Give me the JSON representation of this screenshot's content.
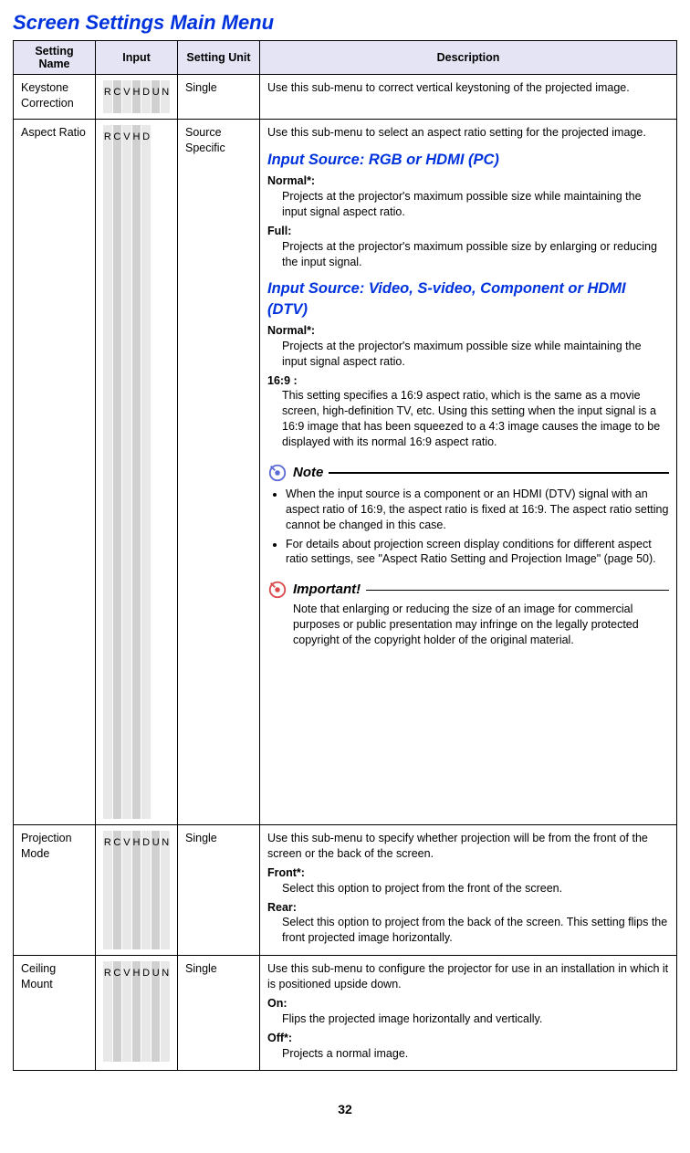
{
  "page": {
    "title": "Screen Settings Main Menu",
    "number": "32"
  },
  "headers": {
    "name": "Setting Name",
    "input": "Input",
    "unit": "Setting Unit",
    "desc": "Description"
  },
  "input_letters": [
    "R",
    "C",
    "V",
    "H",
    "D",
    "U",
    "N"
  ],
  "rows": {
    "keystone": {
      "name": "Keystone Correction",
      "inputs": [
        "R",
        "C",
        "V",
        "H",
        "D",
        "U",
        "N"
      ],
      "unit": "Single",
      "desc": "Use this sub-menu to correct vertical keystoning of the projected image."
    },
    "aspect": {
      "name": "Aspect Ratio",
      "inputs": [
        "R",
        "C",
        "V",
        "H",
        "D"
      ],
      "unit": "Source Specific",
      "intro": "Use this sub-menu to select an aspect ratio setting for the projected image.",
      "src1": {
        "heading": "Input Source: RGB or HDMI (PC)",
        "normal_label": "Normal*:",
        "normal_body": "Projects at the projector's maximum possible size while maintaining the input signal aspect ratio.",
        "full_label": "Full:",
        "full_body": "Projects at the projector's maximum possible size by enlarging or reducing the input signal."
      },
      "src2": {
        "heading": "Input Source: Video, S-video, Component or HDMI (DTV)",
        "normal_label": "Normal*:",
        "normal_body": "Projects at the projector's maximum possible size while maintaining the input signal aspect ratio.",
        "r169_label": "16:9 :",
        "r169_body": "This setting specifies a 16:9 aspect ratio, which is the same as a movie screen, high-definition TV, etc. Using this setting when the input signal is a 16:9 image that has been squeezed to a 4:3 image causes the image to be displayed with its normal 16:9 aspect ratio."
      },
      "note": {
        "title": "Note",
        "b1": "When the input source is a component or an HDMI (DTV) signal with an aspect ratio of 16:9, the aspect ratio is fixed at 16:9. The aspect ratio setting cannot be changed in this case.",
        "b2": "For details about projection screen display conditions for different aspect ratio settings, see \"Aspect Ratio Setting and Projection Image\" (page 50)."
      },
      "important": {
        "title": "Important!",
        "body": "Note that enlarging or reducing the size of an image for commercial purposes or public presentation may infringe on the legally protected copyright of the copyright holder of the original material."
      }
    },
    "projection": {
      "name": "Projection Mode",
      "inputs": [
        "R",
        "C",
        "V",
        "H",
        "D",
        "U",
        "N"
      ],
      "unit": "Single",
      "intro": "Use this sub-menu to specify whether projection will be from the front of the screen or the back of the screen.",
      "front_label": "Front*:",
      "front_body": "Select this option to project from the front of the screen.",
      "rear_label": "Rear:",
      "rear_body": "Select this option to project from the back of the screen. This setting flips the front projected image horizontally."
    },
    "ceiling": {
      "name": "Ceiling Mount",
      "inputs": [
        "R",
        "C",
        "V",
        "H",
        "D",
        "U",
        "N"
      ],
      "unit": "Single",
      "intro": "Use this sub-menu to configure the projector for use in an installation in which it is positioned upside down.",
      "on_label": "On:",
      "on_body": "Flips the projected image horizontally and vertically.",
      "off_label": "Off*:",
      "off_body": "Projects a normal image."
    }
  }
}
